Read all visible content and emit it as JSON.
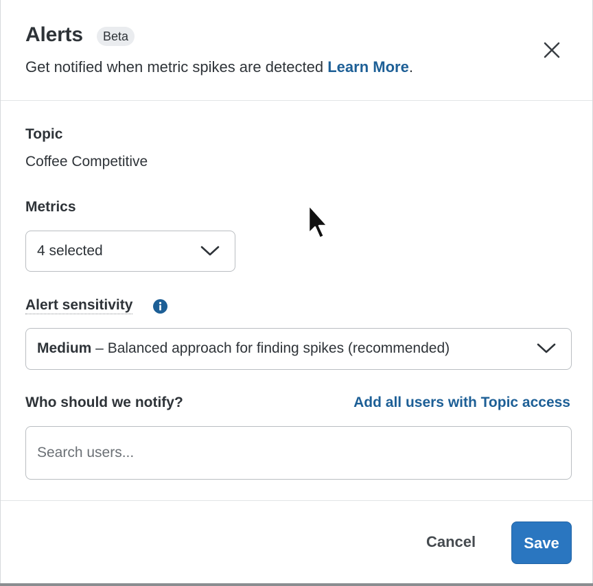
{
  "header": {
    "title": "Alerts",
    "badge": "Beta",
    "subtitle": "Get notified when metric spikes are detected ",
    "learn_more": "Learn More",
    "subtitle_end": ".",
    "close_icon": "close-icon"
  },
  "topic": {
    "label": "Topic",
    "value": "Coffee Competitive"
  },
  "metrics": {
    "label": "Metrics",
    "selected": "4 selected"
  },
  "sensitivity": {
    "label": "Alert sensitivity",
    "info_icon": "info-icon",
    "selected_bold": "Medium",
    "selected_rest": " – Balanced approach for finding spikes (recommended)"
  },
  "notify": {
    "label": "Who should we notify?",
    "add_all_link": "Add all users with Topic access",
    "search_placeholder": "Search users..."
  },
  "footer": {
    "cancel_label": "Cancel",
    "save_label": "Save"
  },
  "colors": {
    "link": "#1d5f96",
    "primary_button": "#2a76c0",
    "text": "#2e3338"
  }
}
